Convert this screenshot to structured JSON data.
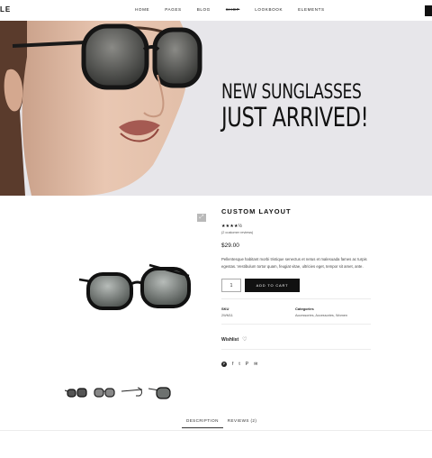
{
  "header": {
    "logo": "LE",
    "nav": [
      "HOME",
      "PAGES",
      "BLOG",
      "SHOP",
      "LOOKBOOK",
      "ELEMENTS"
    ],
    "active_nav": "SHOP"
  },
  "hero": {
    "line1": "NEW SUNGLASSES",
    "line2": "JUST ARRIVED!"
  },
  "product": {
    "title": "CUSTOM LAYOUT",
    "rating": 4.5,
    "stars": "★★★★½",
    "reviews_link": "(2 customer reviews)",
    "price": "$29.00",
    "description": "Pellentesque habitant morbi tristique senectus et netus et malesuada fames ac turpis egestas. Vestibulum tortor quam, feugiat vitae, ultricies eget, tempor sit amet, ante.",
    "quantity": "1",
    "add_to_cart": "ADD TO CART",
    "sku_label": "SKU",
    "sku_value": "2WM11",
    "categories_label": "Categories",
    "categories_value": "Accessories, Accessories, Women",
    "wishlist": "Wishlist",
    "social_icons": [
      "pinterest-circle-icon",
      "facebook-icon",
      "twitter-icon",
      "pinterest-icon",
      "email-icon"
    ]
  },
  "tabs": {
    "description": "DESCRIPTION",
    "reviews": "REVIEWS (2)",
    "active": "DESCRIPTION"
  }
}
